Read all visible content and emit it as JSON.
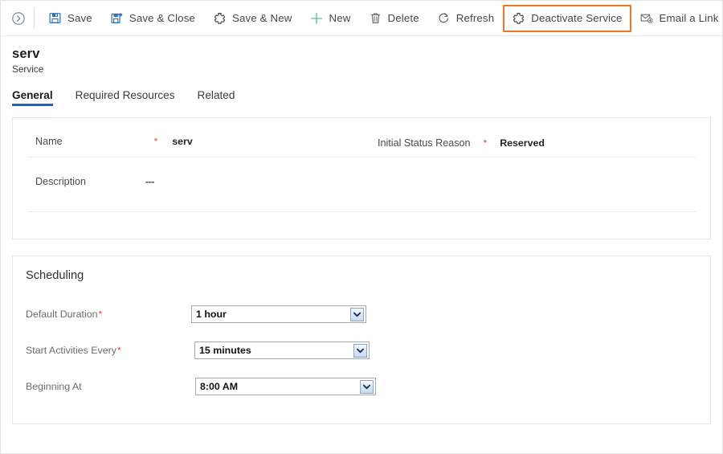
{
  "toolbar": {
    "expand_icon": "chevron-right-circle-icon",
    "buttons": [
      {
        "label": "Save",
        "icon": "save-floppy-icon",
        "highlighted": false
      },
      {
        "label": "Save & Close",
        "icon": "save-and-close-icon",
        "highlighted": false
      },
      {
        "label": "Save & New",
        "icon": "save-and-new-icon",
        "highlighted": false
      },
      {
        "label": "New",
        "icon": "plus-icon",
        "highlighted": false
      },
      {
        "label": "Delete",
        "icon": "trash-icon",
        "highlighted": false
      },
      {
        "label": "Refresh",
        "icon": "refresh-icon",
        "highlighted": false
      },
      {
        "label": "Deactivate Service",
        "icon": "deactivate-icon",
        "highlighted": true
      },
      {
        "label": "Email a Link",
        "icon": "email-link-icon",
        "highlighted": false
      }
    ],
    "overflow_icon": "more-vertical-icon",
    "highlight_color": "#ef7622"
  },
  "record": {
    "title": "serv",
    "subtitle": "Service"
  },
  "tabs": [
    {
      "label": "General",
      "active": true
    },
    {
      "label": "Required Resources",
      "active": false
    },
    {
      "label": "Related",
      "active": false
    }
  ],
  "general": {
    "name": {
      "label": "Name",
      "required_marker": "*",
      "value": "serv"
    },
    "initial_status_reason": {
      "label": "Initial Status Reason",
      "required_marker": "*",
      "value": "Reserved"
    },
    "description": {
      "label": "Description",
      "value": "---"
    }
  },
  "scheduling": {
    "title": "Scheduling",
    "fields": [
      {
        "label": "Default Duration",
        "required_marker": "*",
        "value": "1 hour"
      },
      {
        "label": "Start Activities Every",
        "required_marker": "*",
        "value": "15 minutes"
      },
      {
        "label": "Beginning At",
        "required_marker": "",
        "value": "8:00 AM"
      }
    ]
  },
  "colors": {
    "tab_accent": "#1f5fc4",
    "required_star": "#e04b3c",
    "highlight": "#ef7622"
  }
}
